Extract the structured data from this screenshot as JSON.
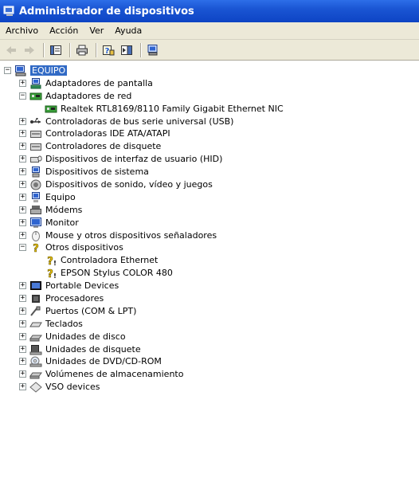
{
  "window": {
    "title": "Administrador de dispositivos"
  },
  "menu": [
    "Archivo",
    "Acción",
    "Ver",
    "Ayuda"
  ],
  "toolbar": [
    {
      "name": "back-icon"
    },
    {
      "name": "forward-icon"
    },
    {
      "sep": true
    },
    {
      "name": "properties-icon"
    },
    {
      "sep": true
    },
    {
      "name": "print-icon"
    },
    {
      "sep": true
    },
    {
      "name": "help-icon"
    },
    {
      "name": "view-icon"
    },
    {
      "sep": true
    },
    {
      "name": "scan-hardware-icon"
    }
  ],
  "root": {
    "label": "EQUIPO",
    "icon": "computer-icon"
  },
  "tree": [
    {
      "label": "Adaptadores de pantalla",
      "icon": "display-adapter-icon",
      "expanded": false
    },
    {
      "label": "Adaptadores de red",
      "icon": "network-adapter-icon",
      "expanded": true,
      "children": [
        {
          "label": "Realtek RTL8169/8110 Family Gigabit Ethernet NIC",
          "icon": "network-card-icon"
        }
      ]
    },
    {
      "label": "Controladoras de bus serie universal (USB)",
      "icon": "usb-icon",
      "expanded": false
    },
    {
      "label": "Controladoras IDE ATA/ATAPI",
      "icon": "ide-controller-icon",
      "expanded": false
    },
    {
      "label": "Controladores de disquete",
      "icon": "floppy-controller-icon",
      "expanded": false
    },
    {
      "label": "Dispositivos de interfaz de usuario (HID)",
      "icon": "hid-icon",
      "expanded": false
    },
    {
      "label": "Dispositivos de sistema",
      "icon": "system-device-icon",
      "expanded": false
    },
    {
      "label": "Dispositivos de sonido, vídeo y juegos",
      "icon": "sound-icon",
      "expanded": false
    },
    {
      "label": "Equipo",
      "icon": "computer-small-icon",
      "expanded": false
    },
    {
      "label": "Módems",
      "icon": "modem-icon",
      "expanded": false
    },
    {
      "label": "Monitor",
      "icon": "monitor-icon",
      "expanded": false
    },
    {
      "label": "Mouse y otros dispositivos señaladores",
      "icon": "mouse-icon",
      "expanded": false
    },
    {
      "label": "Otros dispositivos",
      "icon": "unknown-device-icon",
      "expanded": true,
      "children": [
        {
          "label": "Controladora Ethernet",
          "icon": "warning-unknown-icon"
        },
        {
          "label": "EPSON Stylus COLOR 480",
          "icon": "warning-unknown-icon"
        }
      ]
    },
    {
      "label": "Portable Devices",
      "icon": "portable-device-icon",
      "expanded": false
    },
    {
      "label": "Procesadores",
      "icon": "processor-icon",
      "expanded": false
    },
    {
      "label": "Puertos (COM & LPT)",
      "icon": "port-icon",
      "expanded": false
    },
    {
      "label": "Teclados",
      "icon": "keyboard-icon",
      "expanded": false
    },
    {
      "label": "Unidades de disco",
      "icon": "disk-drive-icon",
      "expanded": false
    },
    {
      "label": "Unidades de disquete",
      "icon": "floppy-drive-icon",
      "expanded": false
    },
    {
      "label": "Unidades de DVD/CD-ROM",
      "icon": "cdrom-icon",
      "expanded": false
    },
    {
      "label": "Volúmenes de almacenamiento",
      "icon": "storage-volume-icon",
      "expanded": false
    },
    {
      "label": "VSO devices",
      "icon": "vso-device-icon",
      "expanded": false
    }
  ]
}
